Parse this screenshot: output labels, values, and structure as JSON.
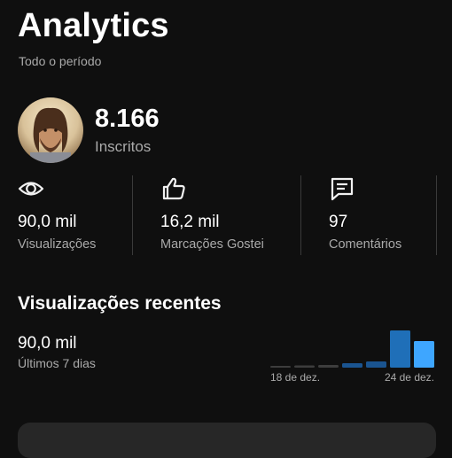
{
  "header": {
    "title": "Analytics",
    "period": "Todo o período"
  },
  "channel": {
    "subscribers": "8.166",
    "subscribers_label": "Inscritos",
    "avatar_icon": "channel-avatar"
  },
  "stats": [
    {
      "icon": "eye-icon",
      "value": "90,0 mil",
      "label": "Visualizações"
    },
    {
      "icon": "thumbs-up-icon",
      "value": "16,2 mil",
      "label": "Marcações Gostei"
    },
    {
      "icon": "comment-icon",
      "value": "97",
      "label": "Comentários"
    }
  ],
  "recent": {
    "title": "Visualizações recentes",
    "value": "90,0 mil",
    "period": "Últimos 7 dias"
  },
  "chart_data": {
    "type": "bar",
    "categories": [
      "",
      "",
      "",
      "",
      "",
      "",
      ""
    ],
    "values": [
      2,
      2.5,
      3,
      5,
      7,
      42,
      30
    ],
    "x_tick_labels": [
      "18 de dez.",
      "24 de dez."
    ],
    "ylim": [
      0,
      42
    ],
    "colors": {
      "empty": "#3d3d3d",
      "low": "#1a5490",
      "high": "#1f6fb8",
      "latest": "#3ea6ff"
    }
  },
  "colors": {
    "background": "#0f0f0f",
    "text_primary": "#f1f1f1",
    "text_secondary": "#aaaaaa"
  }
}
